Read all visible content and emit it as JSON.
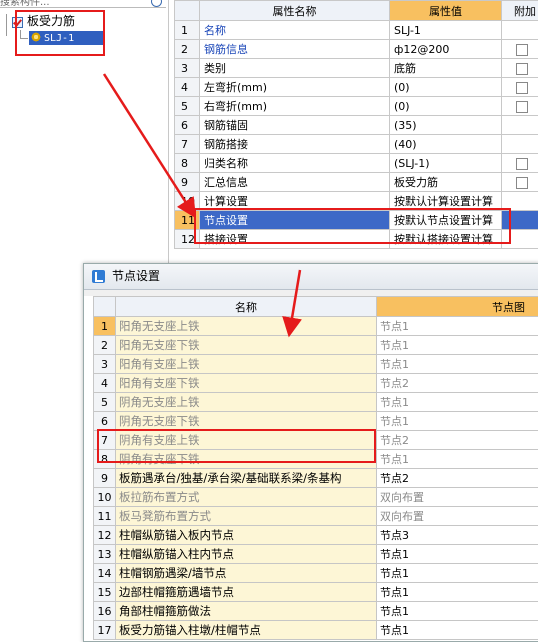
{
  "tree": {
    "search_placeholder": "搜索构件...",
    "root_label": "板受力筋",
    "child_label": "SLJ-1"
  },
  "prop_grid": {
    "headers": {
      "num": "",
      "name": "属性名称",
      "value": "属性值",
      "extra": "附加"
    },
    "rows": [
      {
        "num": "1",
        "name": "名称",
        "value": "SLJ-1",
        "blue": true,
        "checkbox": false
      },
      {
        "num": "2",
        "name": "钢筋信息",
        "value": "ф12@200",
        "blue": true,
        "checkbox": true
      },
      {
        "num": "3",
        "name": "类别",
        "value": "底筋",
        "blue": false,
        "checkbox": true
      },
      {
        "num": "4",
        "name": "左弯折(mm)",
        "value": "(0)",
        "blue": false,
        "checkbox": true
      },
      {
        "num": "5",
        "name": "右弯折(mm)",
        "value": "(0)",
        "blue": false,
        "checkbox": true
      },
      {
        "num": "6",
        "name": "钢筋锚固",
        "value": "(35)",
        "blue": false,
        "checkbox": false
      },
      {
        "num": "7",
        "name": "钢筋搭接",
        "value": "(40)",
        "blue": false,
        "checkbox": false
      },
      {
        "num": "8",
        "name": "归类名称",
        "value": "(SLJ-1)",
        "blue": false,
        "checkbox": true
      },
      {
        "num": "9",
        "name": "汇总信息",
        "value": "板受力筋",
        "blue": false,
        "checkbox": true
      },
      {
        "num": "10",
        "name": "计算设置",
        "value": "按默认计算设置计算",
        "blue": false,
        "checkbox": false
      },
      {
        "num": "11",
        "name": "节点设置",
        "value": "按默认节点设置计算",
        "blue": false,
        "checkbox": false,
        "selected": true
      },
      {
        "num": "12",
        "name": "搭接设置",
        "value": "按默认搭接设置计算",
        "blue": false,
        "checkbox": false
      }
    ]
  },
  "dialog": {
    "title": "节点设置",
    "headers": {
      "num": "",
      "name": "名称",
      "value": "节点图"
    },
    "rows": [
      {
        "num": "1",
        "name": "阳角无支座上铁",
        "value": "节点1",
        "dim": true
      },
      {
        "num": "2",
        "name": "阳角无支座下铁",
        "value": "节点1",
        "dim": true
      },
      {
        "num": "3",
        "name": "阳角有支座上铁",
        "value": "节点1",
        "dim": true
      },
      {
        "num": "4",
        "name": "阳角有支座下铁",
        "value": "节点2",
        "dim": true
      },
      {
        "num": "5",
        "name": "阴角无支座上铁",
        "value": "节点1",
        "dim": true
      },
      {
        "num": "6",
        "name": "阴角无支座下铁",
        "value": "节点1",
        "dim": true
      },
      {
        "num": "7",
        "name": "阴角有支座上铁",
        "value": "节点2",
        "dim": true
      },
      {
        "num": "8",
        "name": "阴角有支座下铁",
        "value": "节点1",
        "dim": true
      },
      {
        "num": "9",
        "name": "板筋遇承台/独基/承台梁/基础联系梁/条基构",
        "value": "节点2",
        "dim": false
      },
      {
        "num": "10",
        "name": "板拉筋布置方式",
        "value": "双向布置",
        "dim": true
      },
      {
        "num": "11",
        "name": "板马凳筋布置方式",
        "value": "双向布置",
        "dim": true
      },
      {
        "num": "12",
        "name": "柱帽纵筋锚入板内节点",
        "value": "节点3",
        "dim": false
      },
      {
        "num": "13",
        "name": "柱帽纵筋锚入柱内节点",
        "value": "节点1",
        "dim": false
      },
      {
        "num": "14",
        "name": "柱帽钢筋遇梁/墙节点",
        "value": "节点1",
        "dim": false
      },
      {
        "num": "15",
        "name": "边部柱帽箍筋遇墙节点",
        "value": "节点1",
        "dim": false
      },
      {
        "num": "16",
        "name": "角部柱帽箍筋做法",
        "value": "节点1",
        "dim": false
      },
      {
        "num": "17",
        "name": "板受力筋锚入柱墩/柱帽节点",
        "value": "节点1",
        "dim": false
      }
    ]
  },
  "colors": {
    "annotation": "#e51b1b",
    "selection": "#3d69c7",
    "header_accent": "#f8c060"
  }
}
